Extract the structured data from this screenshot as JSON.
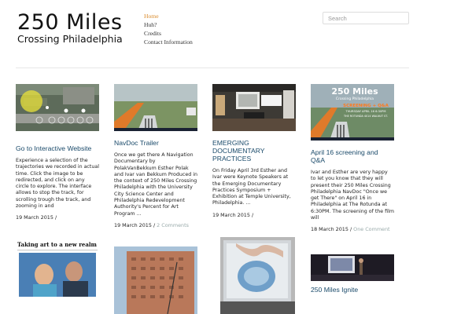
{
  "header": {
    "site_title": "250 Miles",
    "site_tagline": "Crossing Philadelphia",
    "nav": [
      "Home",
      "Huh?",
      "Credits",
      "Contact Information"
    ],
    "search_placeholder": "Search"
  },
  "posts": [
    {
      "title": "Go to Interactive Website",
      "excerpt": "Experience a selection of the trajectories we recorded in actual time. Click the image to be redirected, and click on any circle to explore. The interface allows to stop the track, for scrolling trough the track, and zooming in and",
      "date": "19 March 2015",
      "separator": " /",
      "comments": ""
    },
    {
      "title": "NavDoc Trailer",
      "excerpt": "Once we get there A Navigation Documentary by PolakVanBekkum Esther Polak and Ivar van Bekkum Produced in the context of 250 Miles Crossing Philadelphia with the University City Science Center and Philadelphia Redevelopment Authority's Percent for Art Program ...",
      "date": "19 March 2015",
      "separator": " / ",
      "comments": "2 Comments"
    },
    {
      "title": "EMERGING DOCUMENTARY PRACTICES",
      "excerpt": "On Friday April 3rd Esther and Ivar were Keynote Speakers at the Emerging Documentary Practices Symposium + Exhibition at Temple University, Philadelphia. ...",
      "date": "19 March 2015",
      "separator": " /",
      "comments": ""
    },
    {
      "title": "April 16 screening and Q&A",
      "excerpt": "Ivar and Esther are very happy to let you know that they will present their 250 Miles Crossing Philadelphia NavDoc \"Once we get There\" on April 16 in Philadelphia at The Rotunda at 6:30PM. The screening of the film will",
      "date": "18 March 2015",
      "separator": " / ",
      "comments": "One Comment",
      "thumb_text": {
        "title": "250 Miles",
        "subtitle": "Crossing Philadelphia",
        "screening": "SCREENING + Q&A",
        "date_line": "THURSDAY APRIL 16 6:30PM",
        "venue": "THE ROTUNDA 4014 WALNUT ST."
      }
    },
    {
      "thumb_text": {
        "headline": "Taking art to a new realm"
      }
    },
    {},
    {},
    {
      "title": "250 Miles Ignite"
    }
  ],
  "colors": {
    "nav_active": "#d98a2b",
    "post_title": "#1a4a6a",
    "comments_link": "#99aaaa",
    "divider": "#e6e6e6"
  }
}
